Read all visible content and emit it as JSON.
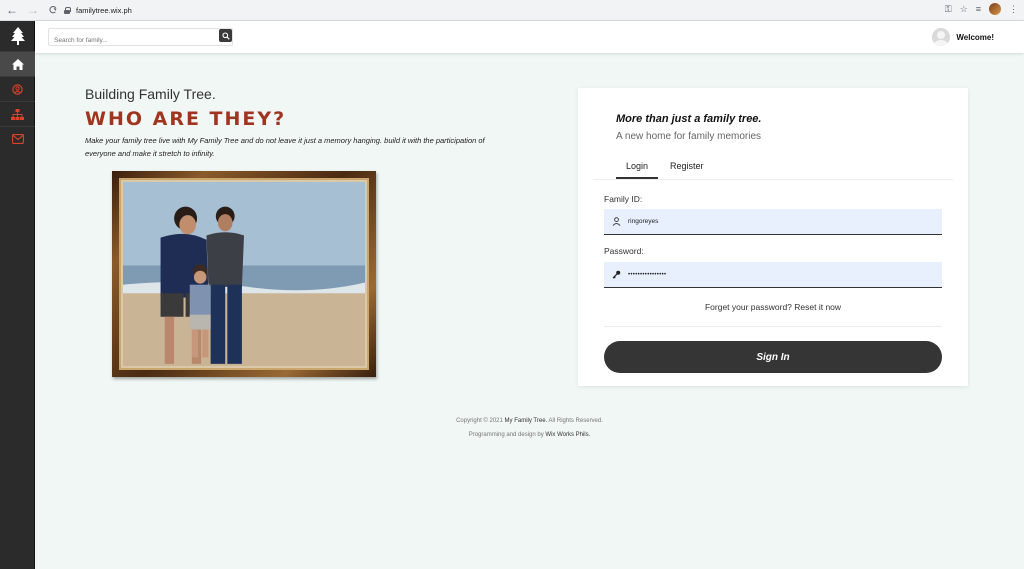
{
  "browser": {
    "url": "familytree.wix.ph"
  },
  "header": {
    "search_placeholder": "Search for family...",
    "welcome": "Welcome!"
  },
  "hero": {
    "subtitle": "Building Family Tree.",
    "title": "WHO ARE THEY?",
    "description": "Make your family tree live with My Family Tree and do not leave it just a memory hanging. build it with the participation of everyone and make it stretch to infinity."
  },
  "login": {
    "heading": "More than just a family tree.",
    "subheading": "A new home for family memories",
    "tabs": [
      "Login",
      "Register"
    ],
    "family_id_label": "Family ID:",
    "family_id_value": "ringoreyes",
    "password_label": "Password:",
    "password_value": "••••••••••••••••",
    "forgot_text": "Forget your password? Reset it now",
    "sign_in_label": "Sign In"
  },
  "footer": {
    "copyright_prefix": "Copyright © 2021",
    "brand": "My Family Tree.",
    "copyright_suffix": "All Rights Reserved.",
    "credit_prefix": "Programming and design by",
    "credit_name": "Wix Works Phils."
  },
  "colors": {
    "accent": "#a0341f",
    "sidebar": "#2b2b2b",
    "background": "#f0f7f5",
    "icon_red": "#d9432a"
  },
  "icons": {
    "sidebar": [
      "tree-icon",
      "home-icon",
      "user-circle-icon",
      "sitemap-icon",
      "mail-icon"
    ]
  }
}
